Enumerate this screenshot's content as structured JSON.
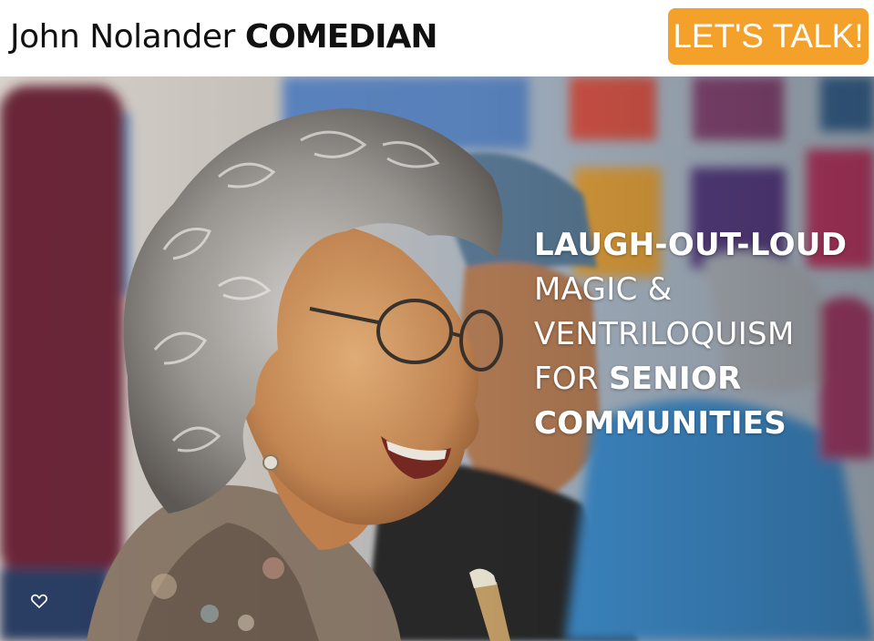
{
  "header": {
    "brand_name": "John Nolander",
    "brand_title": "COMEDIAN",
    "cta_label": "LET'S TALK!"
  },
  "hero": {
    "headline": {
      "line1": "LAUGH-OUT-LOUD",
      "line2": "MAGIC &",
      "line3": "VENTRILOQUISM",
      "line4_prefix": "FOR",
      "line4_strong": "SENIOR",
      "line5": "COMMUNITIES"
    },
    "image_description_icon": "smiling-senior-woman-photo",
    "favorite_icon": "heart-outline-icon"
  },
  "colors": {
    "accent": "#F4A12B",
    "text_dark": "#111111",
    "hero_text": "#FFFFFF"
  }
}
